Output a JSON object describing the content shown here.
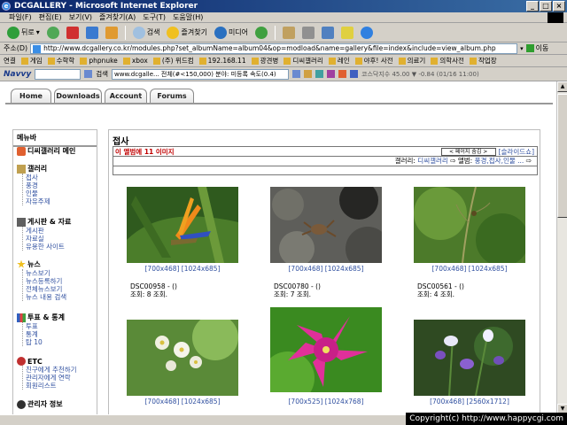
{
  "window": {
    "title": "DCGALLERY - Microsoft Internet Explorer"
  },
  "menu": [
    "파일(F)",
    "편집(E)",
    "보기(V)",
    "즐겨찾기(A)",
    "도구(T)",
    "도움말(H)"
  ],
  "toolbar": {
    "back": "뒤로",
    "search": "검색",
    "favorites": "즐겨찾기",
    "media": "미디어"
  },
  "address": {
    "label": "주소(D)",
    "url": "http://www.dcgallery.co.kr/modules.php?set_albumName=album04&op=modload&name=gallery&file=index&include=view_album.php",
    "go": "이동"
  },
  "links": {
    "label": "연결",
    "items": [
      "게임",
      "수학학",
      "phpnuke",
      "xbox",
      "(주) 위드컴",
      "192.168.11",
      "광견병",
      "디씨갤러리",
      "레인",
      "야후! 사전",
      "의료기",
      "의학사전",
      "작업장"
    ]
  },
  "navy": {
    "brand": "Navvy",
    "search_label": "검색",
    "search_value": "www.dcgalle...  전체(#<150,000)  분야: 미등록  속도(0.4)",
    "stock": "코스닥지수 45.00 ▼ -0.84 (01/16 11:00)"
  },
  "tabs": [
    "Home",
    "Downloads",
    "Account",
    "Forums"
  ],
  "sidebar": {
    "header": "메뉴바",
    "sections": [
      {
        "title": "디씨갤러리 메인",
        "items": []
      },
      {
        "title": "갤러리",
        "items": [
          "접사",
          "풍경",
          "인물",
          "자유주제"
        ]
      },
      {
        "title": "게시판 & 자료",
        "items": [
          "게시판",
          "자료실",
          "유용한 사이트"
        ]
      },
      {
        "title": "뉴스",
        "items": [
          "뉴스보기",
          "뉴스등록하기",
          "전체뉴스보기",
          "뉴스 내용 검색"
        ]
      },
      {
        "title": "투표 & 통계",
        "items": [
          "투표",
          "통계",
          "탑 10"
        ]
      },
      {
        "title": "ETC",
        "items": [
          "친구에게 추천하기",
          "관리자에게 연락",
          "회원리스트"
        ]
      },
      {
        "title": "관리자 정보",
        "items": []
      }
    ]
  },
  "album": {
    "title": "접사",
    "info": "이 앨범에 11 이미지",
    "select": "< 페이지 숨김 >",
    "slideshow": "[슬라이드쇼]",
    "breadcrumb_label": "갤러리:",
    "breadcrumb_gallery": "디씨갤러리",
    "breadcrumb_album_label": "앨범:",
    "breadcrumb_album": "풍경,접사,인물 ...",
    "photos": [
      {
        "sizes": "[700x468] [1024x685]",
        "name": "DSC00958 - ()",
        "views": "조회: 8 조회."
      },
      {
        "sizes": "[700x468] [1024x685]",
        "name": "DSC00780 - ()",
        "views": "조회: 7 조회."
      },
      {
        "sizes": "[700x468] [1024x685]",
        "name": "DSC00561 - ()",
        "views": "조회: 4 조회."
      },
      {
        "sizes": "[700x468] [1024x685]",
        "name": "",
        "views": ""
      },
      {
        "sizes": "[700x525] [1024x768]",
        "name": "",
        "views": ""
      },
      {
        "sizes": "[700x468] [2560x1712]",
        "name": "",
        "views": ""
      }
    ]
  },
  "copyright": "Copyright(c) http://www.happycgi.com"
}
